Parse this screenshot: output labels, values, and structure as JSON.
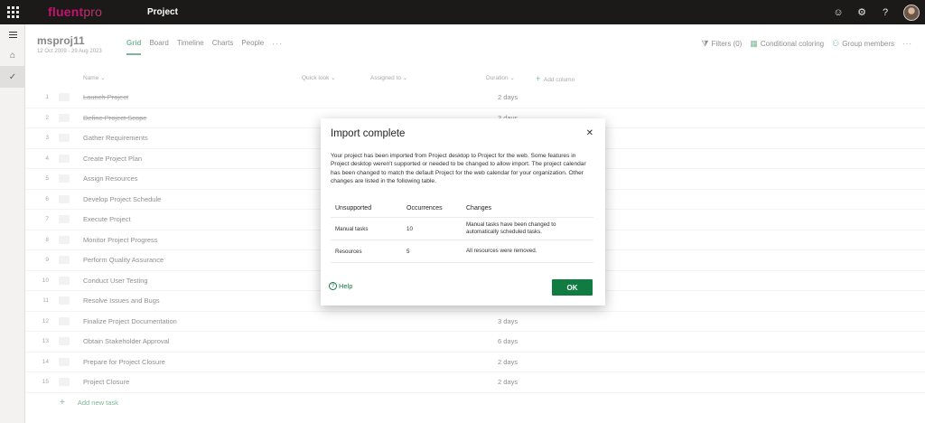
{
  "app": {
    "logo_prefix": "fluent",
    "logo_suffix": "pro",
    "app_name": "Project"
  },
  "project": {
    "title": "msproj11",
    "dates": "12 Oct 2009 - 29 Aug 2023"
  },
  "tabs": [
    {
      "label": "Grid",
      "active": true
    },
    {
      "label": "Board"
    },
    {
      "label": "Timeline"
    },
    {
      "label": "Charts"
    },
    {
      "label": "People"
    }
  ],
  "tab_more": "···",
  "tools": {
    "filters": "Filters (0)",
    "conditional": "Conditional coloring",
    "group": "Group members",
    "more": "···"
  },
  "columns": {
    "name": "Name",
    "quick_look": "Quick look",
    "assigned_to": "Assigned to",
    "duration": "Duration",
    "add_column": "Add column"
  },
  "rows": [
    {
      "num": "1",
      "name": "Launch Project",
      "duration": "2 days",
      "done": true
    },
    {
      "num": "2",
      "name": "Define Project Scope",
      "duration": "3 days",
      "done": true
    },
    {
      "num": "3",
      "name": "Gather Requirements",
      "duration": ""
    },
    {
      "num": "4",
      "name": "Create Project Plan",
      "duration": ""
    },
    {
      "num": "5",
      "name": "Assign Resources",
      "duration": ""
    },
    {
      "num": "6",
      "name": "Develop Project Schedule",
      "duration": ""
    },
    {
      "num": "7",
      "name": "Execute Project",
      "duration": ""
    },
    {
      "num": "8",
      "name": "Monitor Project Progress",
      "duration": ""
    },
    {
      "num": "9",
      "name": "Perform Quality Assurance",
      "duration": ""
    },
    {
      "num": "10",
      "name": "Conduct User Testing",
      "duration": ""
    },
    {
      "num": "11",
      "name": "Resolve Issues and Bugs",
      "duration": ""
    },
    {
      "num": "12",
      "name": "Finalize Project Documentation",
      "duration": "3 days"
    },
    {
      "num": "13",
      "name": "Obtain Stakeholder Approval",
      "duration": "6 days"
    },
    {
      "num": "14",
      "name": "Prepare for Project Closure",
      "duration": "2 days"
    },
    {
      "num": "15",
      "name": "Project Closure",
      "duration": "2 days"
    }
  ],
  "add_task": "Add new task",
  "dialog": {
    "title": "Import complete",
    "body": "Your project has been imported from Project desktop to Project for the web. Some features in Project desktop weren't supported or needed to be changed to allow import. The project calendar has been changed to match the default Project for the web calendar for your organization. Other changes are listed in the following table.",
    "table_headers": [
      "Unsupported",
      "Occurrences",
      "Changes"
    ],
    "table_rows": [
      [
        "Manual tasks",
        "10",
        "Manual tasks have been changed to automatically scheduled tasks."
      ],
      [
        "Resources",
        "5",
        "All resources were removed."
      ]
    ],
    "help": "Help",
    "ok": "OK"
  },
  "colors": {
    "accent": "#107c41",
    "topbar": "#1b1a19",
    "logo": "#c4136f"
  }
}
